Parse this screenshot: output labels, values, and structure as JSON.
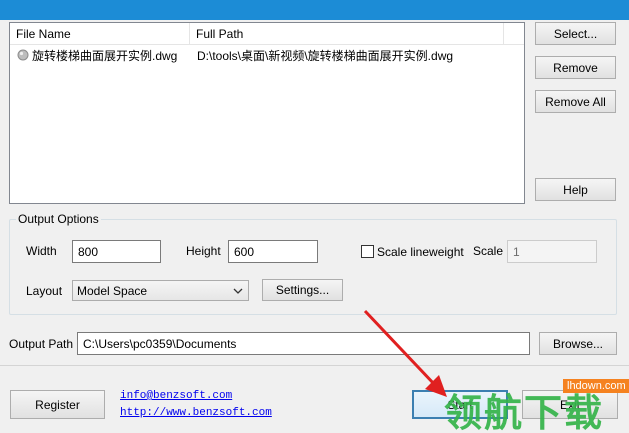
{
  "file_list": {
    "columns": [
      "File Name",
      "Full Path"
    ],
    "rows": [
      {
        "name": "旋转楼梯曲面展开实例.dwg",
        "path": "D:\\tools\\桌面\\新视频\\旋转楼梯曲面展开实例.dwg"
      }
    ]
  },
  "side_buttons": {
    "select": "Select...",
    "remove": "Remove",
    "remove_all": "Remove All",
    "help": "Help"
  },
  "output_options": {
    "title": "Output Options",
    "width_label": "Width",
    "width_value": "800",
    "height_label": "Height",
    "height_value": "600",
    "scale_lineweight_label": "Scale lineweight",
    "scale_lineweight_checked": false,
    "scale_label": "Scale",
    "scale_value": "1",
    "layout_label": "Layout",
    "layout_value": "Model Space",
    "settings_button": "Settings..."
  },
  "output_path": {
    "label": "Output Path",
    "value": "C:\\Users\\pc0359\\Documents",
    "browse_button": "Browse..."
  },
  "footer": {
    "register_button": "Register",
    "email_link": "info@benzsoft.com",
    "web_link": "http://www.benzsoft.com",
    "start_button": "Start",
    "exit_button": "Exit"
  },
  "watermark": {
    "text": "领航下载",
    "url": "lhdown.com",
    "color": "#35b44a"
  },
  "colors": {
    "accent": "#1c8cd6",
    "arrow": "#e02020"
  }
}
